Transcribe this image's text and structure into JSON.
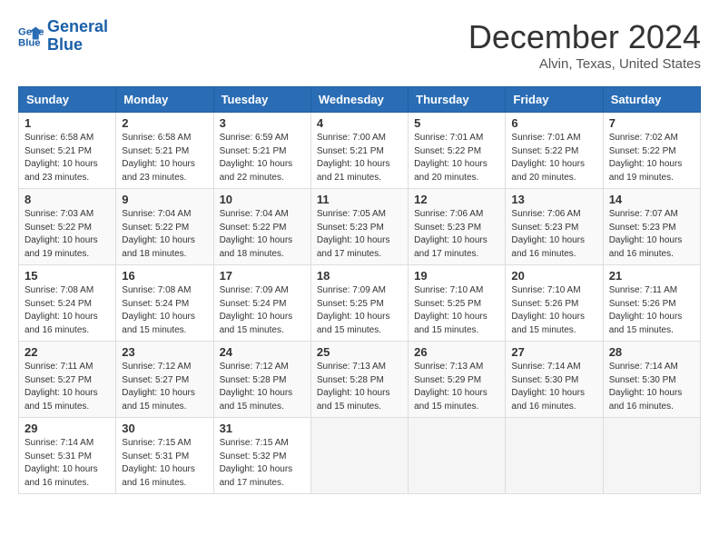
{
  "header": {
    "logo_line1": "General",
    "logo_line2": "Blue",
    "month": "December 2024",
    "location": "Alvin, Texas, United States"
  },
  "weekdays": [
    "Sunday",
    "Monday",
    "Tuesday",
    "Wednesday",
    "Thursday",
    "Friday",
    "Saturday"
  ],
  "weeks": [
    [
      {
        "day": "1",
        "sunrise": "Sunrise: 6:58 AM",
        "sunset": "Sunset: 5:21 PM",
        "daylight": "Daylight: 10 hours and 23 minutes."
      },
      {
        "day": "2",
        "sunrise": "Sunrise: 6:58 AM",
        "sunset": "Sunset: 5:21 PM",
        "daylight": "Daylight: 10 hours and 23 minutes."
      },
      {
        "day": "3",
        "sunrise": "Sunrise: 6:59 AM",
        "sunset": "Sunset: 5:21 PM",
        "daylight": "Daylight: 10 hours and 22 minutes."
      },
      {
        "day": "4",
        "sunrise": "Sunrise: 7:00 AM",
        "sunset": "Sunset: 5:21 PM",
        "daylight": "Daylight: 10 hours and 21 minutes."
      },
      {
        "day": "5",
        "sunrise": "Sunrise: 7:01 AM",
        "sunset": "Sunset: 5:22 PM",
        "daylight": "Daylight: 10 hours and 20 minutes."
      },
      {
        "day": "6",
        "sunrise": "Sunrise: 7:01 AM",
        "sunset": "Sunset: 5:22 PM",
        "daylight": "Daylight: 10 hours and 20 minutes."
      },
      {
        "day": "7",
        "sunrise": "Sunrise: 7:02 AM",
        "sunset": "Sunset: 5:22 PM",
        "daylight": "Daylight: 10 hours and 19 minutes."
      }
    ],
    [
      {
        "day": "8",
        "sunrise": "Sunrise: 7:03 AM",
        "sunset": "Sunset: 5:22 PM",
        "daylight": "Daylight: 10 hours and 19 minutes."
      },
      {
        "day": "9",
        "sunrise": "Sunrise: 7:04 AM",
        "sunset": "Sunset: 5:22 PM",
        "daylight": "Daylight: 10 hours and 18 minutes."
      },
      {
        "day": "10",
        "sunrise": "Sunrise: 7:04 AM",
        "sunset": "Sunset: 5:22 PM",
        "daylight": "Daylight: 10 hours and 18 minutes."
      },
      {
        "day": "11",
        "sunrise": "Sunrise: 7:05 AM",
        "sunset": "Sunset: 5:23 PM",
        "daylight": "Daylight: 10 hours and 17 minutes."
      },
      {
        "day": "12",
        "sunrise": "Sunrise: 7:06 AM",
        "sunset": "Sunset: 5:23 PM",
        "daylight": "Daylight: 10 hours and 17 minutes."
      },
      {
        "day": "13",
        "sunrise": "Sunrise: 7:06 AM",
        "sunset": "Sunset: 5:23 PM",
        "daylight": "Daylight: 10 hours and 16 minutes."
      },
      {
        "day": "14",
        "sunrise": "Sunrise: 7:07 AM",
        "sunset": "Sunset: 5:23 PM",
        "daylight": "Daylight: 10 hours and 16 minutes."
      }
    ],
    [
      {
        "day": "15",
        "sunrise": "Sunrise: 7:08 AM",
        "sunset": "Sunset: 5:24 PM",
        "daylight": "Daylight: 10 hours and 16 minutes."
      },
      {
        "day": "16",
        "sunrise": "Sunrise: 7:08 AM",
        "sunset": "Sunset: 5:24 PM",
        "daylight": "Daylight: 10 hours and 15 minutes."
      },
      {
        "day": "17",
        "sunrise": "Sunrise: 7:09 AM",
        "sunset": "Sunset: 5:24 PM",
        "daylight": "Daylight: 10 hours and 15 minutes."
      },
      {
        "day": "18",
        "sunrise": "Sunrise: 7:09 AM",
        "sunset": "Sunset: 5:25 PM",
        "daylight": "Daylight: 10 hours and 15 minutes."
      },
      {
        "day": "19",
        "sunrise": "Sunrise: 7:10 AM",
        "sunset": "Sunset: 5:25 PM",
        "daylight": "Daylight: 10 hours and 15 minutes."
      },
      {
        "day": "20",
        "sunrise": "Sunrise: 7:10 AM",
        "sunset": "Sunset: 5:26 PM",
        "daylight": "Daylight: 10 hours and 15 minutes."
      },
      {
        "day": "21",
        "sunrise": "Sunrise: 7:11 AM",
        "sunset": "Sunset: 5:26 PM",
        "daylight": "Daylight: 10 hours and 15 minutes."
      }
    ],
    [
      {
        "day": "22",
        "sunrise": "Sunrise: 7:11 AM",
        "sunset": "Sunset: 5:27 PM",
        "daylight": "Daylight: 10 hours and 15 minutes."
      },
      {
        "day": "23",
        "sunrise": "Sunrise: 7:12 AM",
        "sunset": "Sunset: 5:27 PM",
        "daylight": "Daylight: 10 hours and 15 minutes."
      },
      {
        "day": "24",
        "sunrise": "Sunrise: 7:12 AM",
        "sunset": "Sunset: 5:28 PM",
        "daylight": "Daylight: 10 hours and 15 minutes."
      },
      {
        "day": "25",
        "sunrise": "Sunrise: 7:13 AM",
        "sunset": "Sunset: 5:28 PM",
        "daylight": "Daylight: 10 hours and 15 minutes."
      },
      {
        "day": "26",
        "sunrise": "Sunrise: 7:13 AM",
        "sunset": "Sunset: 5:29 PM",
        "daylight": "Daylight: 10 hours and 15 minutes."
      },
      {
        "day": "27",
        "sunrise": "Sunrise: 7:14 AM",
        "sunset": "Sunset: 5:30 PM",
        "daylight": "Daylight: 10 hours and 16 minutes."
      },
      {
        "day": "28",
        "sunrise": "Sunrise: 7:14 AM",
        "sunset": "Sunset: 5:30 PM",
        "daylight": "Daylight: 10 hours and 16 minutes."
      }
    ],
    [
      {
        "day": "29",
        "sunrise": "Sunrise: 7:14 AM",
        "sunset": "Sunset: 5:31 PM",
        "daylight": "Daylight: 10 hours and 16 minutes."
      },
      {
        "day": "30",
        "sunrise": "Sunrise: 7:15 AM",
        "sunset": "Sunset: 5:31 PM",
        "daylight": "Daylight: 10 hours and 16 minutes."
      },
      {
        "day": "31",
        "sunrise": "Sunrise: 7:15 AM",
        "sunset": "Sunset: 5:32 PM",
        "daylight": "Daylight: 10 hours and 17 minutes."
      },
      null,
      null,
      null,
      null
    ]
  ]
}
